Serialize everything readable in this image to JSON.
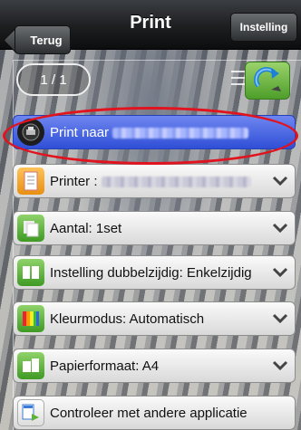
{
  "header": {
    "title": "Print",
    "back_label": "Terug",
    "settings_label": "Instelling"
  },
  "preview": {
    "page_counter": "1 / 1"
  },
  "rows": [
    {
      "label": "Print naar",
      "icon": "printer-device-icon",
      "redacted": true,
      "active": true
    },
    {
      "label": "Printer :",
      "icon": "document-icon",
      "redacted": true,
      "active": false
    },
    {
      "label": "Aantal: 1set",
      "icon": "copies-icon",
      "redacted": false,
      "active": false
    },
    {
      "label": "Instelling dubbelzijdig: Enkelzijdig",
      "icon": "duplex-icon",
      "redacted": false,
      "active": false
    },
    {
      "label": "Kleurmodus: Automatisch",
      "icon": "color-mode-icon",
      "redacted": false,
      "active": false
    },
    {
      "label": "Papierformaat: A4",
      "icon": "paper-size-icon",
      "redacted": false,
      "active": false
    },
    {
      "label": "Controleer met andere applicatie",
      "icon": "app-check-icon",
      "redacted": false,
      "active": false
    }
  ],
  "colors": {
    "active_row": "#3b5ae0",
    "highlight": "#e0131e",
    "icon_green": "#5cb338",
    "icon_orange": "#f0a020"
  }
}
